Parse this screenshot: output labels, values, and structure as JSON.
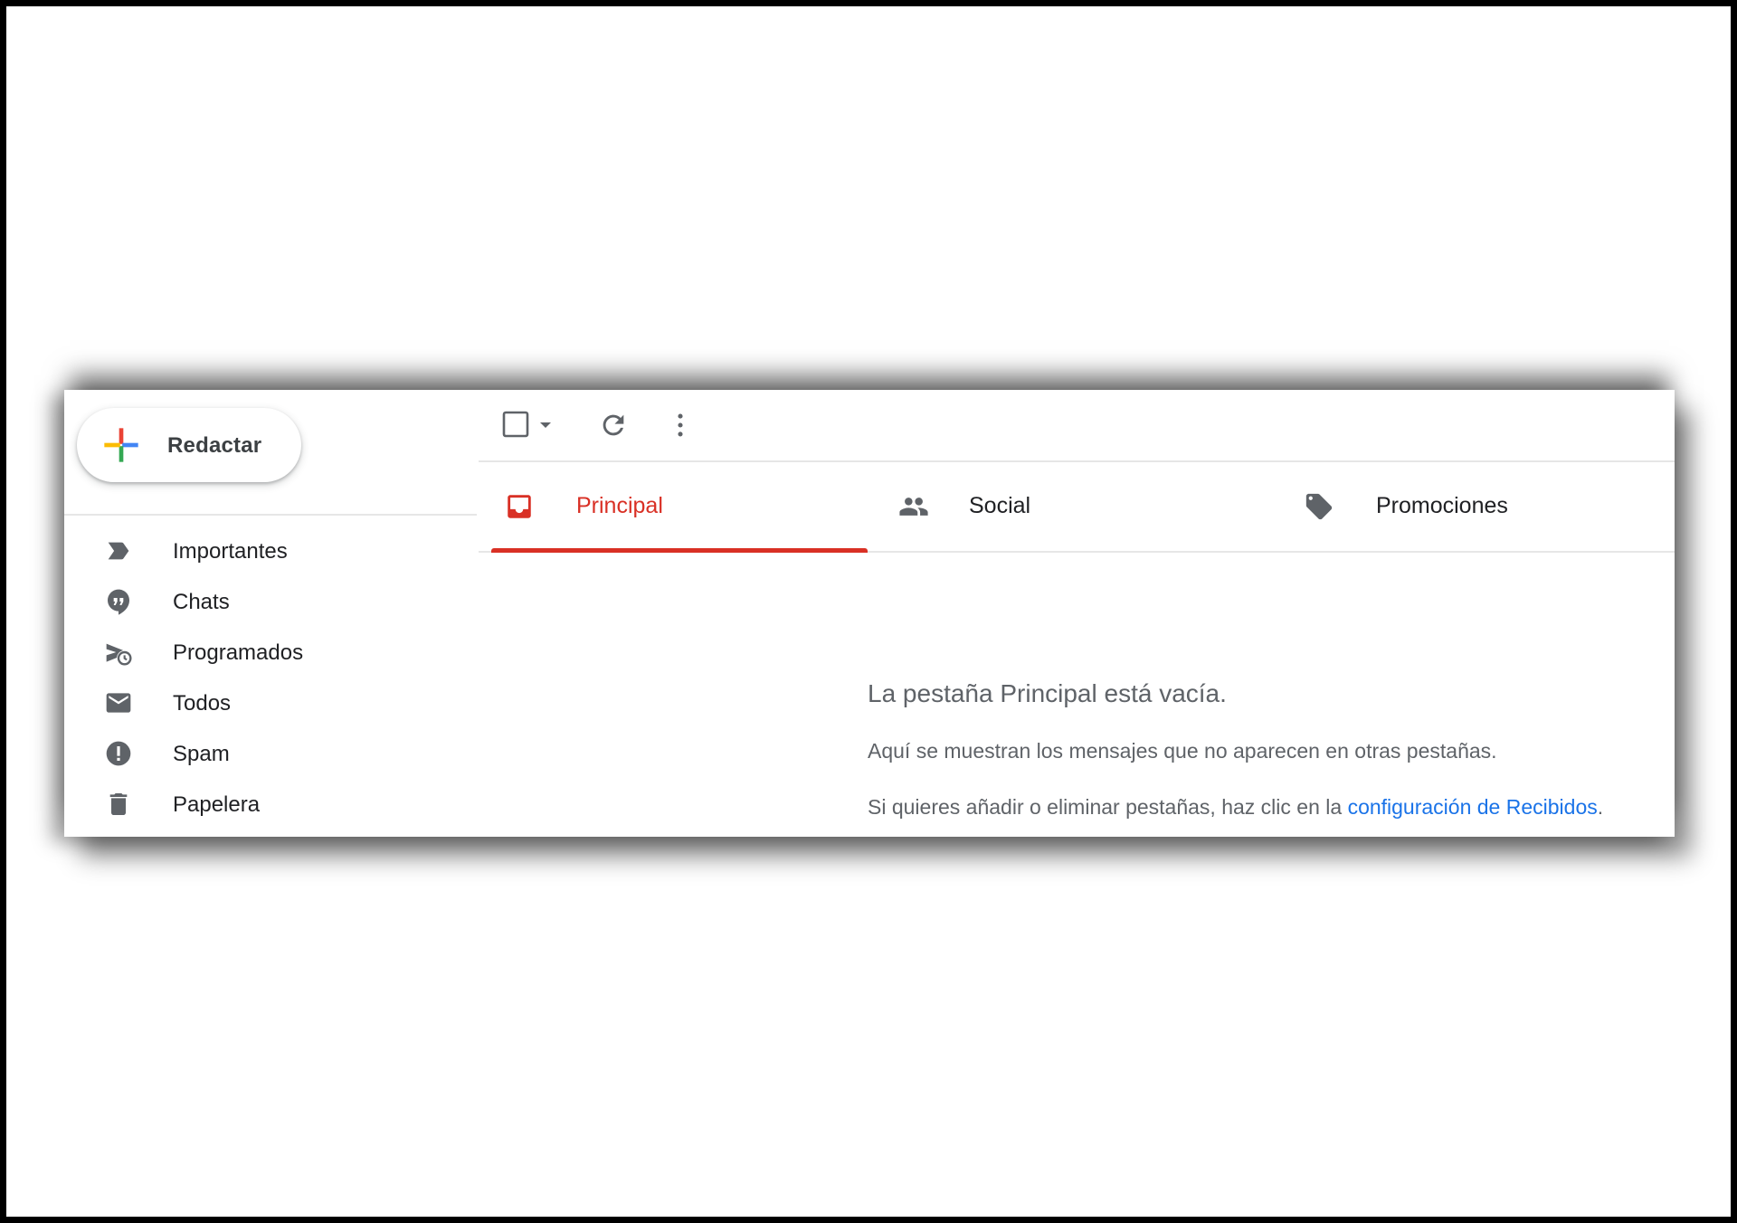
{
  "compose": {
    "label": "Redactar"
  },
  "sidebar": {
    "items": [
      {
        "label": "Importantes",
        "icon": "label-important-icon"
      },
      {
        "label": "Chats",
        "icon": "chat-icon"
      },
      {
        "label": "Programados",
        "icon": "scheduled-send-icon"
      },
      {
        "label": "Todos",
        "icon": "mail-icon"
      },
      {
        "label": "Spam",
        "icon": "spam-icon"
      },
      {
        "label": "Papelera",
        "icon": "trash-icon"
      }
    ]
  },
  "toolbar": {
    "select_icon": "checkbox-icon",
    "refresh_icon": "refresh-icon",
    "more_icon": "more-vert-icon"
  },
  "tabs": [
    {
      "label": "Principal",
      "icon": "inbox-icon",
      "active": true
    },
    {
      "label": "Social",
      "icon": "people-icon",
      "active": false
    },
    {
      "label": "Promociones",
      "icon": "tag-icon",
      "active": false
    }
  ],
  "empty_state": {
    "title": "La pestaña Principal está vacía.",
    "line1": "Aquí se muestran los mensajes que no aparecen en otras pestañas.",
    "line2_prefix": "Si quieres añadir o eliminar pestañas, haz clic en la ",
    "line2_link": "configuración de Recibidos",
    "line2_suffix": "."
  },
  "colors": {
    "accent": "#d93025",
    "link": "#1a73e8",
    "text": "#202124",
    "muted": "#5f6368",
    "icon": "#5f6368"
  }
}
